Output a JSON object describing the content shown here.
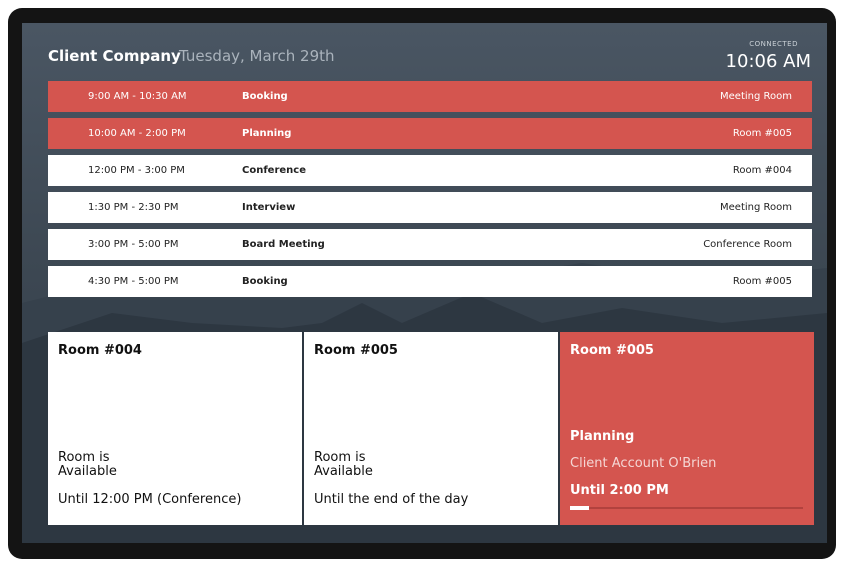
{
  "header": {
    "company": "Client Company",
    "date": "Tuesday, March 29th",
    "status": "CONNECTED",
    "time": "10:06 AM"
  },
  "events": [
    {
      "time": "9:00 AM - 10:30 AM",
      "title": "Booking",
      "room": "Meeting Room",
      "active": true
    },
    {
      "time": "10:00 AM - 2:00 PM",
      "title": "Planning",
      "room": "Room #005",
      "active": true
    },
    {
      "time": "12:00 PM - 3:00 PM",
      "title": "Conference",
      "room": "Room #004",
      "active": false
    },
    {
      "time": "1:30 PM - 2:30 PM",
      "title": "Interview",
      "room": "Meeting Room",
      "active": false
    },
    {
      "time": "3:00 PM - 5:00 PM",
      "title": "Board Meeting",
      "room": "Conference Room",
      "active": false
    },
    {
      "time": "4:30 PM - 5:00 PM",
      "title": "Booking",
      "room": "Room #005",
      "active": false
    }
  ],
  "rooms": [
    {
      "name": "Room #004",
      "status_line1": "Room is",
      "status_line2": "Available",
      "until": "Until 12:00 PM (Conference)"
    },
    {
      "name": "Room #005",
      "status_line1": "Room is",
      "status_line2": "Available",
      "until": "Until the end of the day"
    },
    {
      "name": "Room #005",
      "meeting": "Planning",
      "organizer": "Client Account O'Brien",
      "until": "Until 2:00 PM",
      "progress": 0.08
    }
  ],
  "colors": {
    "accent": "#d4554f",
    "row_background": "#ffffff",
    "text_dark": "#222222"
  }
}
